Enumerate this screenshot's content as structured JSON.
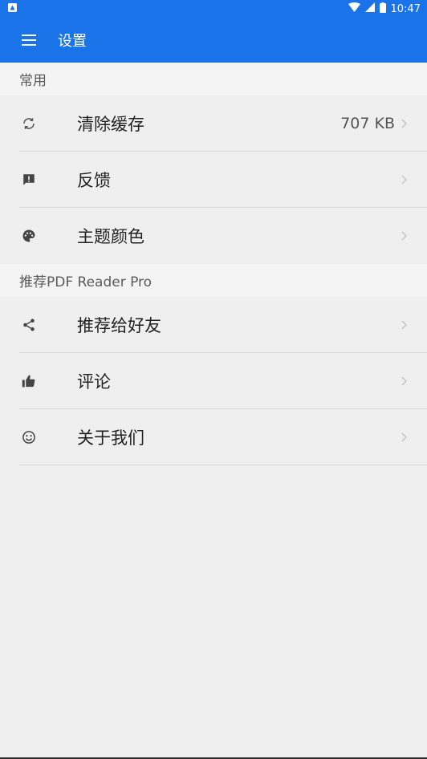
{
  "status_bar": {
    "time": "10:47"
  },
  "app_bar": {
    "title": "设置"
  },
  "sections": [
    {
      "header": "常用",
      "items": [
        {
          "label": "清除缓存",
          "value": "707 KB",
          "icon": "refresh-icon"
        },
        {
          "label": "反馈",
          "value": "",
          "icon": "feedback-icon"
        },
        {
          "label": "主题颜色",
          "value": "",
          "icon": "palette-icon"
        }
      ]
    },
    {
      "header": "推荐PDF Reader Pro",
      "items": [
        {
          "label": "推荐给好友",
          "value": "",
          "icon": "share-icon"
        },
        {
          "label": "评论",
          "value": "",
          "icon": "thumbs-up-icon"
        },
        {
          "label": "关于我们",
          "value": "",
          "icon": "smiley-icon"
        }
      ]
    }
  ],
  "colors": {
    "primary": "#1a73e8",
    "background": "#efefef"
  }
}
